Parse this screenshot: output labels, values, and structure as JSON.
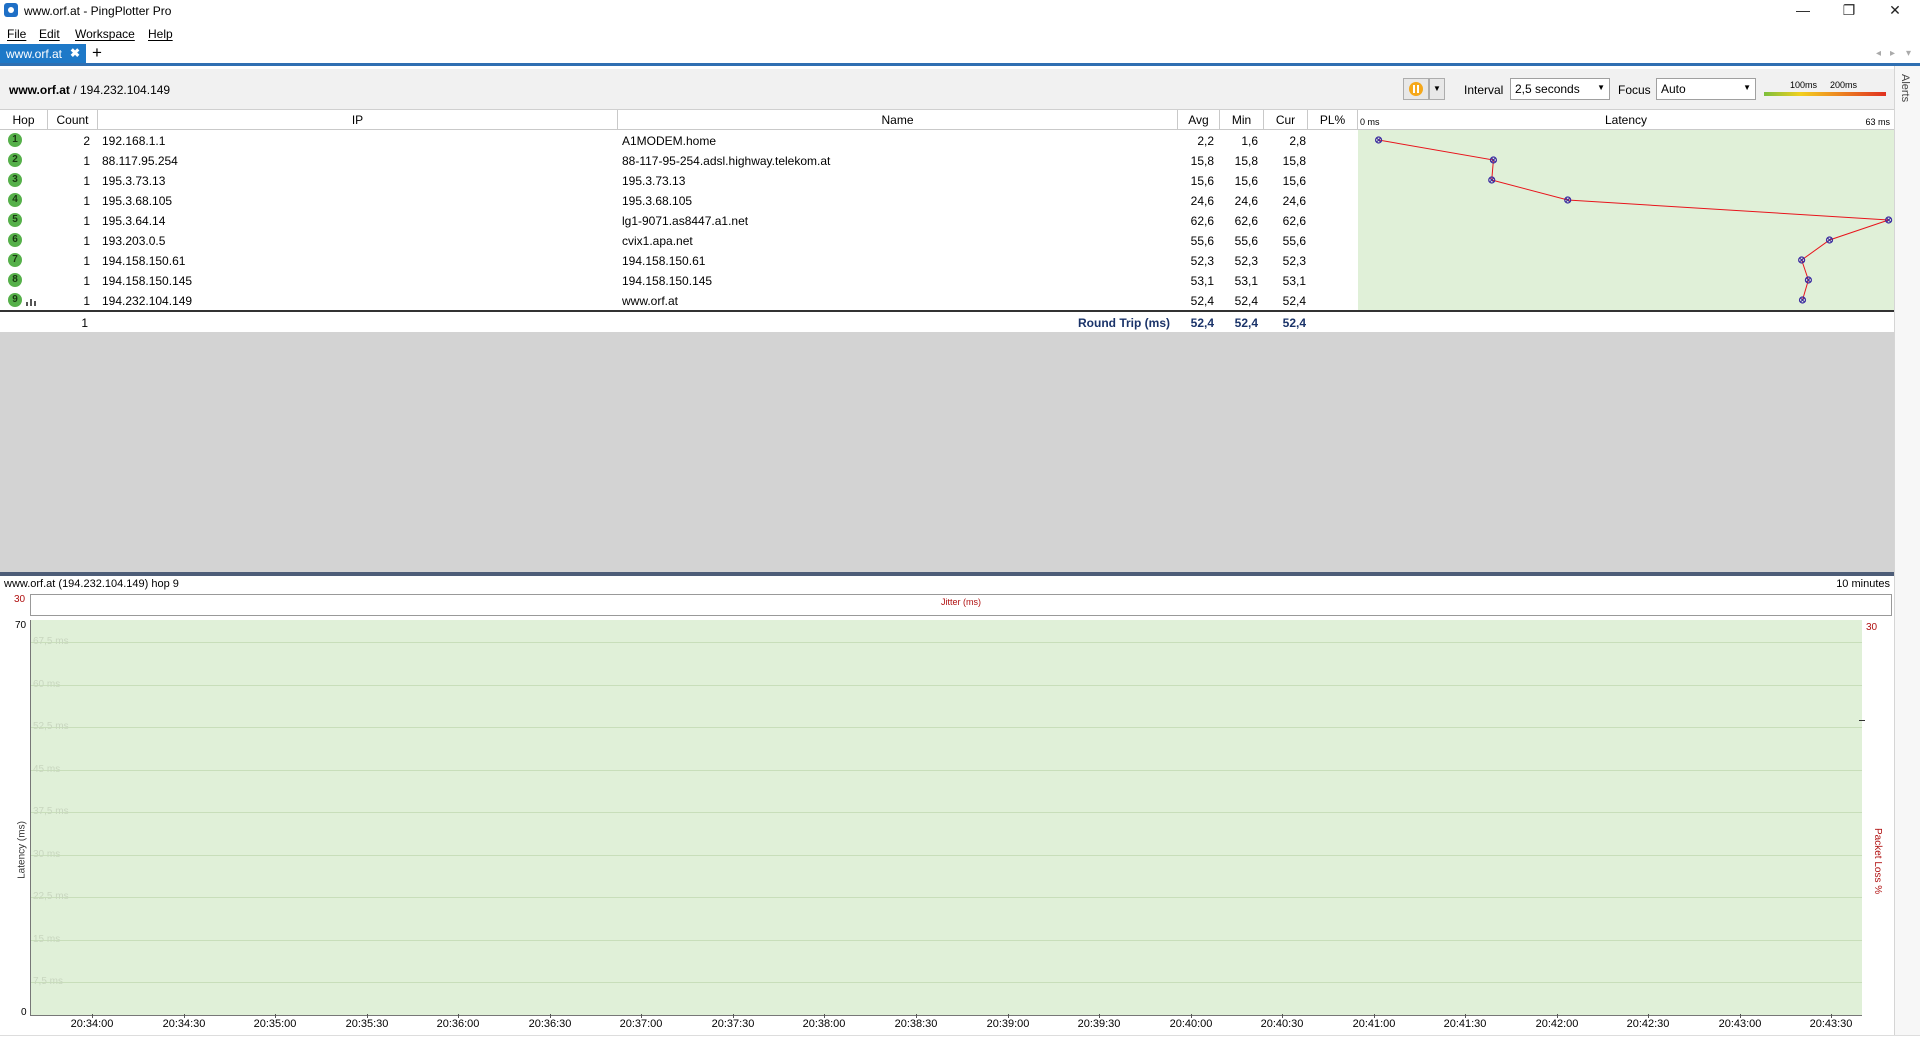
{
  "window": {
    "title": "www.orf.at - PingPlotter Pro",
    "minimize": "—",
    "restore": "❐",
    "close": "✕"
  },
  "menu": [
    "File",
    "Edit",
    "Workspace",
    "Help"
  ],
  "tab": {
    "label": "www.orf.at",
    "close": "✖",
    "add": "+"
  },
  "target": {
    "host": "www.orf.at",
    "ip": " / 194.232.104.149",
    "interval_label": "Interval",
    "interval_value": "2,5 seconds",
    "focus_label": "Focus",
    "focus_value": "Auto",
    "scale_100": "100ms",
    "scale_200": "200ms"
  },
  "alerts": "Alerts",
  "table": {
    "headers": {
      "hop": "Hop",
      "count": "Count",
      "ip": "IP",
      "name": "Name",
      "avg": "Avg",
      "min": "Min",
      "cur": "Cur",
      "pl": "PL%"
    },
    "rows": [
      {
        "hop": "1",
        "count": "2",
        "ip": "192.168.1.1",
        "name": "A1MODEM.home",
        "avg": "2,2",
        "min": "1,6",
        "cur": "2,8",
        "latency": 2.2
      },
      {
        "hop": "2",
        "count": "1",
        "ip": "88.117.95.254",
        "name": "88-117-95-254.adsl.highway.telekom.at",
        "avg": "15,8",
        "min": "15,8",
        "cur": "15,8",
        "latency": 15.8
      },
      {
        "hop": "3",
        "count": "1",
        "ip": "195.3.73.13",
        "name": "195.3.73.13",
        "avg": "15,6",
        "min": "15,6",
        "cur": "15,6",
        "latency": 15.6
      },
      {
        "hop": "4",
        "count": "1",
        "ip": "195.3.68.105",
        "name": "195.3.68.105",
        "avg": "24,6",
        "min": "24,6",
        "cur": "24,6",
        "latency": 24.6
      },
      {
        "hop": "5",
        "count": "1",
        "ip": "195.3.64.14",
        "name": "lg1-9071.as8447.a1.net",
        "avg": "62,6",
        "min": "62,6",
        "cur": "62,6",
        "latency": 62.6
      },
      {
        "hop": "6",
        "count": "1",
        "ip": "193.203.0.5",
        "name": "cvix1.apa.net",
        "avg": "55,6",
        "min": "55,6",
        "cur": "55,6",
        "latency": 55.6
      },
      {
        "hop": "7",
        "count": "1",
        "ip": "194.158.150.61",
        "name": "194.158.150.61",
        "avg": "52,3",
        "min": "52,3",
        "cur": "52,3",
        "latency": 52.3
      },
      {
        "hop": "8",
        "count": "1",
        "ip": "194.158.150.145",
        "name": "194.158.150.145",
        "avg": "53,1",
        "min": "53,1",
        "cur": "53,1",
        "latency": 53.1
      },
      {
        "hop": "9",
        "count": "1",
        "ip": "194.232.104.149",
        "name": "www.orf.at",
        "avg": "52,4",
        "min": "52,4",
        "cur": "52,4",
        "latency": 52.4
      }
    ],
    "round_trip": {
      "count": "1",
      "label": "Round Trip (ms)",
      "avg": "52,4",
      "min": "52,4",
      "cur": "52,4"
    }
  },
  "latency_graph": {
    "title": "Latency",
    "min_label": "0 ms",
    "max_label": "63 ms",
    "max_value": 63,
    "line_color": "#e8141c",
    "marker_color": "#3a2aa0"
  },
  "timeline": {
    "title": "www.orf.at (194.232.104.149) hop 9",
    "range": "10 minutes",
    "jitter_label": "Jitter (ms)",
    "jitter_max": "30",
    "y_max": "70",
    "y_zero": "0",
    "right_max": "30",
    "y_axis_label": "Latency (ms)",
    "right_axis_label": "Packet Loss %",
    "grid_labels": [
      "67,5 ms",
      "60 ms",
      "52,5 ms",
      "45 ms",
      "37,5 ms",
      "30 ms",
      "22,5 ms",
      "15 ms",
      "7,5 ms"
    ],
    "x_ticks": [
      "20:34:00",
      "20:34:30",
      "20:35:00",
      "20:35:30",
      "20:36:00",
      "20:36:30",
      "20:37:00",
      "20:37:30",
      "20:38:00",
      "20:38:30",
      "20:39:00",
      "20:39:30",
      "20:40:00",
      "20:40:30",
      "20:41:00",
      "20:41:30",
      "20:42:00",
      "20:42:30",
      "20:43:00",
      "20:43:30"
    ]
  }
}
